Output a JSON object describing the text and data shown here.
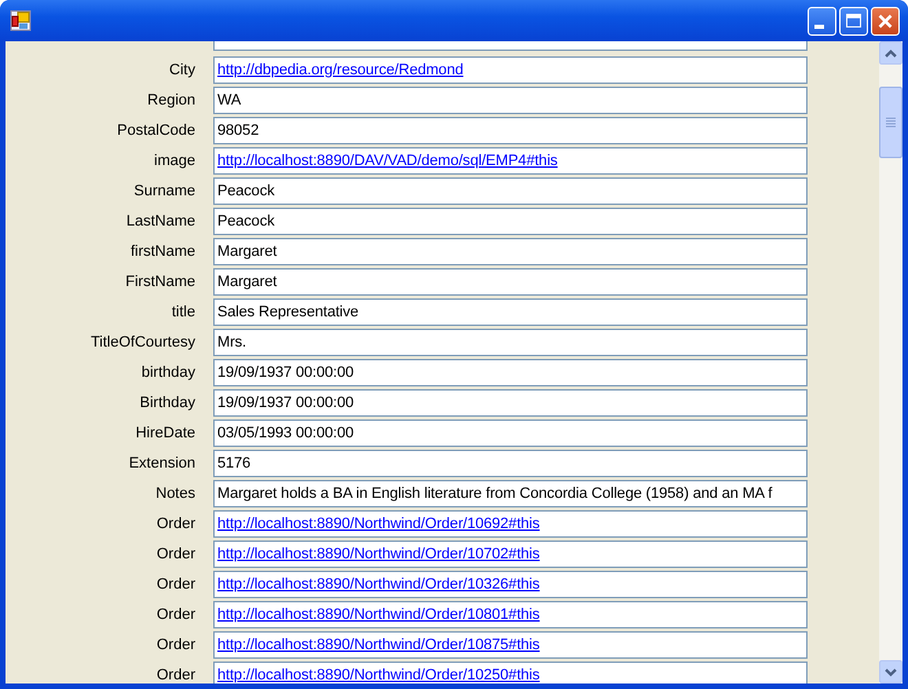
{
  "fields": [
    {
      "label": "City",
      "value": "http://dbpedia.org/resource/Redmond",
      "kind": "link"
    },
    {
      "label": "Region",
      "value": "WA",
      "kind": "text"
    },
    {
      "label": "PostalCode",
      "value": "98052",
      "kind": "text"
    },
    {
      "label": "image",
      "value": "http://localhost:8890/DAV/VAD/demo/sql/EMP4#this",
      "kind": "link"
    },
    {
      "label": "Surname",
      "value": "Peacock",
      "kind": "text"
    },
    {
      "label": "LastName",
      "value": "Peacock",
      "kind": "text"
    },
    {
      "label": "firstName",
      "value": "Margaret",
      "kind": "text"
    },
    {
      "label": "FirstName",
      "value": "Margaret",
      "kind": "text"
    },
    {
      "label": "title",
      "value": "Sales Representative",
      "kind": "text"
    },
    {
      "label": "TitleOfCourtesy",
      "value": "Mrs.",
      "kind": "text"
    },
    {
      "label": "birthday",
      "value": "19/09/1937 00:00:00",
      "kind": "text"
    },
    {
      "label": "Birthday",
      "value": "19/09/1937 00:00:00",
      "kind": "text"
    },
    {
      "label": "HireDate",
      "value": "03/05/1993 00:00:00",
      "kind": "text"
    },
    {
      "label": "Extension",
      "value": "5176",
      "kind": "text"
    },
    {
      "label": "Notes",
      "value": "Margaret holds a BA in English literature from Concordia College (1958) and an MA f",
      "kind": "text"
    },
    {
      "label": "Order",
      "value": "http://localhost:8890/Northwind/Order/10692#this",
      "kind": "link"
    },
    {
      "label": "Order",
      "value": "http://localhost:8890/Northwind/Order/10702#this",
      "kind": "link"
    },
    {
      "label": "Order",
      "value": "http://localhost:8890/Northwind/Order/10326#this",
      "kind": "link"
    },
    {
      "label": "Order",
      "value": "http://localhost:8890/Northwind/Order/10801#this",
      "kind": "link"
    },
    {
      "label": "Order",
      "value": "http://localhost:8890/Northwind/Order/10875#this",
      "kind": "link"
    },
    {
      "label": "Order",
      "value": "http://localhost:8890/Northwind/Order/10250#this",
      "kind": "link"
    }
  ]
}
